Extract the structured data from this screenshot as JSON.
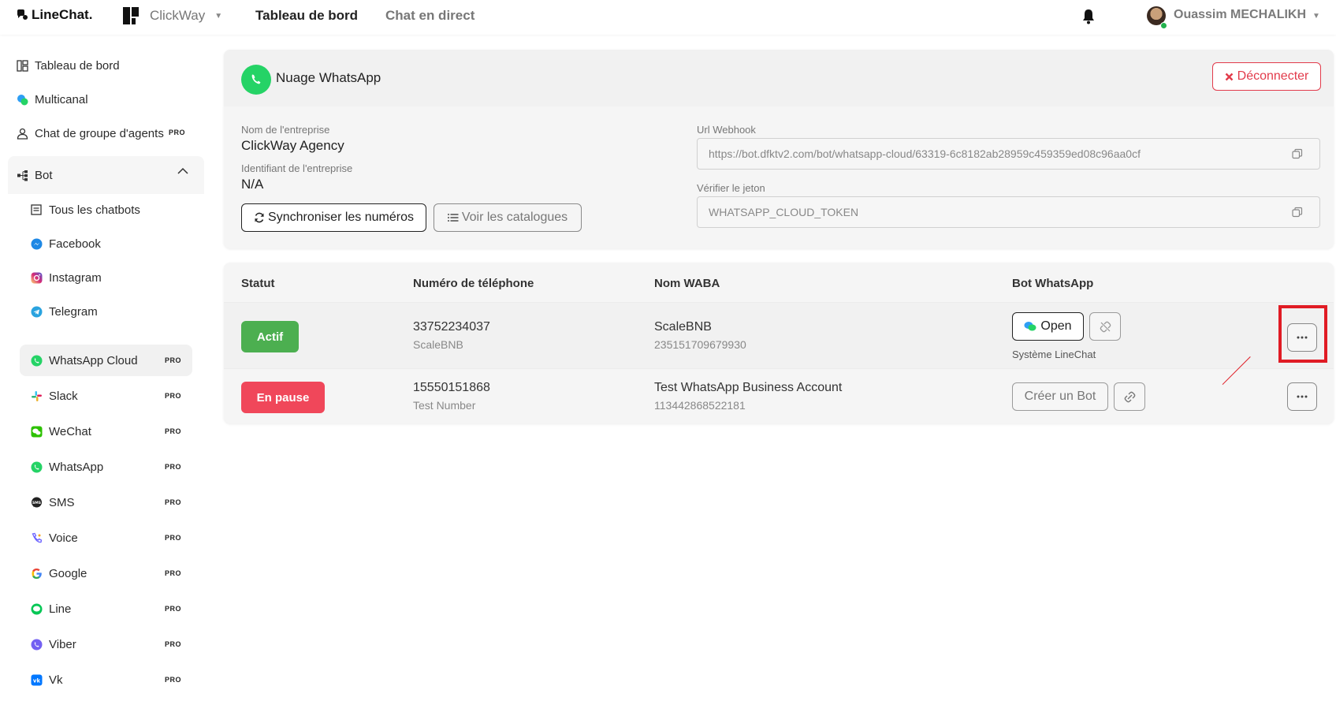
{
  "topbar": {
    "brand": "LineChat.",
    "workspace": "ClickWay",
    "nav_active": "Tableau de bord",
    "nav_other": "Chat en direct",
    "user_name": "Ouassim MECHALIKH"
  },
  "sidebar": {
    "top_items": [
      {
        "label": "Tableau de bord",
        "icon": "dashboard-icon"
      },
      {
        "label": "Multicanal",
        "icon": "chat-bubbles-icon"
      },
      {
        "label": "Chat de groupe d'agents",
        "icon": "user-icon",
        "badge": "PRO"
      },
      {
        "label": "Bot",
        "icon": "flow-icon"
      }
    ],
    "sub_items": [
      {
        "label": "Tous les chatbots",
        "icon": "list-icon",
        "badge": ""
      },
      {
        "label": "Facebook",
        "icon": "messenger-icon",
        "badge": ""
      },
      {
        "label": "Instagram",
        "icon": "instagram-icon",
        "badge": ""
      },
      {
        "label": "Telegram",
        "icon": "telegram-icon",
        "badge": ""
      },
      {
        "label": "WhatsApp Cloud",
        "icon": "whatsapp-icon",
        "badge": "PRO"
      },
      {
        "label": "Slack",
        "icon": "slack-icon",
        "badge": "PRO"
      },
      {
        "label": "WeChat",
        "icon": "wechat-icon",
        "badge": "PRO"
      },
      {
        "label": "WhatsApp",
        "icon": "whatsapp-icon",
        "badge": "PRO"
      },
      {
        "label": "SMS",
        "icon": "sms-icon",
        "badge": "PRO"
      },
      {
        "label": "Voice",
        "icon": "phone-icon",
        "badge": "PRO"
      },
      {
        "label": "Google",
        "icon": "google-icon",
        "badge": "PRO"
      },
      {
        "label": "Line",
        "icon": "line-icon",
        "badge": "PRO"
      },
      {
        "label": "Viber",
        "icon": "viber-icon",
        "badge": "PRO"
      },
      {
        "label": "Vk",
        "icon": "vk-icon",
        "badge": "PRO"
      }
    ]
  },
  "account": {
    "title": "Nuage WhatsApp",
    "disconnect_label": "Déconnecter",
    "company_name_label": "Nom de l'entreprise",
    "company_name": "ClickWay Agency",
    "company_id_label": "Identifiant de l'entreprise",
    "company_id": "N/A",
    "sync_label": "Synchroniser les numéros",
    "catalog_label": "Voir les catalogues",
    "webhook_label": "Url Webhook",
    "webhook_url": "https://bot.dfktv2.com/bot/whatsapp-cloud/63319-6c8182ab28959c459359ed08c96aa0cf",
    "token_label": "Vérifier le jeton",
    "token": "WHATSAPP_CLOUD_TOKEN"
  },
  "table": {
    "headers": [
      "Statut",
      "Numéro de téléphone",
      "Nom WABA",
      "Bot WhatsApp"
    ],
    "rows": [
      {
        "status": "Actif",
        "phone": "33752234037",
        "phone_name": "ScaleBNB",
        "waba_name": "ScaleBNB",
        "waba_id": "235151709679930",
        "bot_label": "Open",
        "bot_system": "Système LineChat"
      },
      {
        "status": "En pause",
        "phone": "15550151868",
        "phone_name": "Test Number",
        "waba_name": "Test WhatsApp Business Account",
        "waba_id": "113442868522181",
        "bot_label": "Créer un Bot"
      }
    ]
  },
  "colors": {
    "active": "#4caf50",
    "paused": "#f0475a",
    "disconnect": "#e23b4b",
    "whatsapp": "#25d366",
    "highlight": "#e01b24"
  }
}
